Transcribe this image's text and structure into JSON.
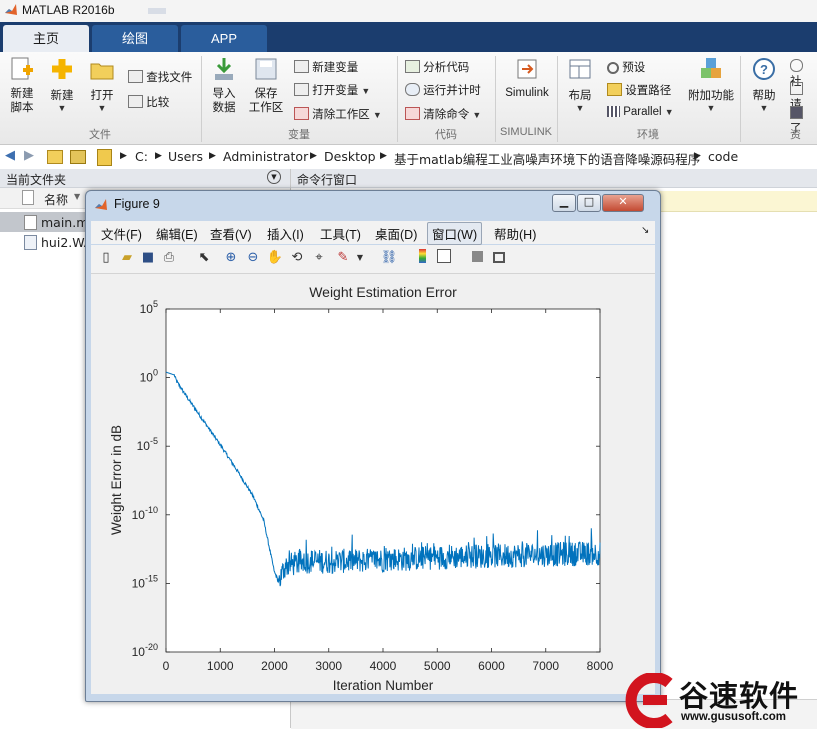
{
  "app": {
    "title": "MATLAB R2016b",
    "tabs": [
      "主页",
      "绘图",
      "APP"
    ]
  },
  "ribbon": {
    "new_script": "新建\n脚本",
    "new": "新建",
    "open": "打开",
    "find_files": "查找文件",
    "compare": "比较",
    "import_data": "导入\n数据",
    "save_workspace": "保存\n工作区",
    "new_variable": "新建变量",
    "open_variable": "打开变量",
    "clear_workspace": "清除工作区",
    "analyze_code": "分析代码",
    "run_and_time": "运行并计时",
    "clear_commands": "清除命令",
    "simulink": "Simulink",
    "layout": "布局",
    "preferences": "预设",
    "set_path": "设置路径",
    "parallel": "Parallel",
    "addons": "附加功能",
    "help": "帮助",
    "cut_1": "社",
    "cut_2": "请",
    "cut_3": "了",
    "groups": [
      "文件",
      "变量",
      "代码",
      "SIMULINK",
      "环境",
      "资"
    ]
  },
  "address": {
    "segments": [
      "C:",
      "Users",
      "Administrator",
      "Desktop",
      "基于matlab编程工业高噪声环境下的语音降噪源码程序",
      "code"
    ]
  },
  "current_folder": {
    "header": "当前文件夹",
    "column_name": "名称",
    "files": [
      {
        "name": "main.m",
        "icon": "matlab-file-icon"
      },
      {
        "name": "hui2.WAV",
        "icon": "wav-file-icon"
      }
    ]
  },
  "command_window": {
    "header": "命令行窗口"
  },
  "figure": {
    "title": "Figure 9",
    "menu": [
      "文件(F)",
      "编辑(E)",
      "查看(V)",
      "插入(I)",
      "工具(T)",
      "桌面(D)",
      "窗口(W)",
      "帮助(H)"
    ],
    "toolbar_icons": [
      "new-figure-icon",
      "open-file-icon",
      "save-icon",
      "print-icon",
      "pointer-icon",
      "zoom-in-icon",
      "zoom-out-icon",
      "pan-icon",
      "rotate-icon",
      "data-cursor-icon",
      "brush-icon",
      "link-icon",
      "colorbar-icon",
      "legend-icon",
      "hide-tools-icon",
      "show-tools-icon"
    ]
  },
  "chart_data": {
    "type": "line",
    "title": "Weight Estimation Error",
    "xlabel": "Iteration Number",
    "ylabel": "Weight Error in dB",
    "xlim": [
      0,
      8000
    ],
    "ylim_exp": [
      -20,
      5
    ],
    "yscale": "log",
    "xticks": [
      "0",
      "1000",
      "2000",
      "3000",
      "4000",
      "5000",
      "6000",
      "7000",
      "8000"
    ],
    "yticks": [
      {
        "base": "10",
        "exp": "5"
      },
      {
        "base": "10",
        "exp": "0"
      },
      {
        "base": "10",
        "exp": "-5"
      },
      {
        "base": "10",
        "exp": "-10"
      },
      {
        "base": "10",
        "exp": "-15"
      },
      {
        "base": "10",
        "exp": "-20"
      }
    ],
    "line_color": "#0072bd",
    "series": [
      {
        "description_points": [
          [
            0,
            0.4
          ],
          [
            150,
            0.2
          ],
          [
            200,
            -0.3
          ],
          [
            400,
            -1.5
          ],
          [
            700,
            -3.2
          ],
          [
            1000,
            -4.9
          ],
          [
            1300,
            -6.7
          ],
          [
            1600,
            -8.6
          ],
          [
            1800,
            -10.4
          ],
          [
            1900,
            -12.3
          ],
          [
            2000,
            -14.2
          ],
          [
            2080,
            -14.9
          ],
          [
            2200,
            -13.7
          ],
          [
            2600,
            -13.4
          ],
          [
            3000,
            -13.4
          ],
          [
            4000,
            -13.3
          ],
          [
            5000,
            -13.1
          ],
          [
            6000,
            -13.0
          ],
          [
            7000,
            -12.9
          ],
          [
            8000,
            -12.8
          ]
        ],
        "noise_amplitude_exp": 1.0
      }
    ]
  },
  "watermark": {
    "brand": "谷速软件",
    "url": "www.gususoft.com"
  },
  "colors": {
    "tabbar": "#1b3d6e",
    "plot_line": "#0072bd",
    "watermark_red": "#d2141e"
  }
}
